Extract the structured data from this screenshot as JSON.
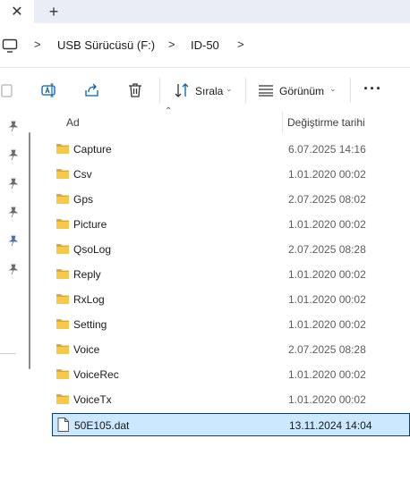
{
  "tabs": {
    "close_glyph": "✕",
    "new_glyph": "+"
  },
  "address": {
    "icon": "computer-icon",
    "breadcrumbs": [
      "USB Sürücüsü (F:)",
      "ID-50"
    ],
    "separator": ">"
  },
  "toolbar": {
    "icons": [
      "paste-icon",
      "rename-icon",
      "share-icon",
      "delete-icon",
      "sort-icon",
      "view-icon",
      "more-icon"
    ],
    "sort_label": "Sırala",
    "view_label": "Görünüm",
    "more_label": "···"
  },
  "nav": {
    "pinned_count": 6,
    "icon": "pin-icon"
  },
  "columns": {
    "name": "Ad",
    "date": "Değiştirme tarihi"
  },
  "files": [
    {
      "name": "Capture",
      "date": "6.07.2025 14:16",
      "type": "folder"
    },
    {
      "name": "Csv",
      "date": "1.01.2020 00:02",
      "type": "folder"
    },
    {
      "name": "Gps",
      "date": "2.07.2025 08:02",
      "type": "folder"
    },
    {
      "name": "Picture",
      "date": "1.01.2020 00:02",
      "type": "folder"
    },
    {
      "name": "QsoLog",
      "date": "2.07.2025 08:28",
      "type": "folder"
    },
    {
      "name": "Reply",
      "date": "1.01.2020 00:02",
      "type": "folder"
    },
    {
      "name": "RxLog",
      "date": "1.01.2020 00:02",
      "type": "folder"
    },
    {
      "name": "Setting",
      "date": "1.01.2020 00:02",
      "type": "folder"
    },
    {
      "name": "Voice",
      "date": "2.07.2025 08:28",
      "type": "folder"
    },
    {
      "name": "VoiceRec",
      "date": "1.01.2020 00:02",
      "type": "folder"
    },
    {
      "name": "VoiceTx",
      "date": "1.01.2020 00:02",
      "type": "folder"
    },
    {
      "name": "50E105.dat",
      "date": "13.11.2024 14:04",
      "type": "file",
      "selected": true
    }
  ],
  "colors": {
    "folder": "#f7c948",
    "folder_dark": "#e4a82a",
    "selection_bg": "#cce8ff",
    "selection_border": "#0f3d6b",
    "accent": "#005fb8"
  }
}
